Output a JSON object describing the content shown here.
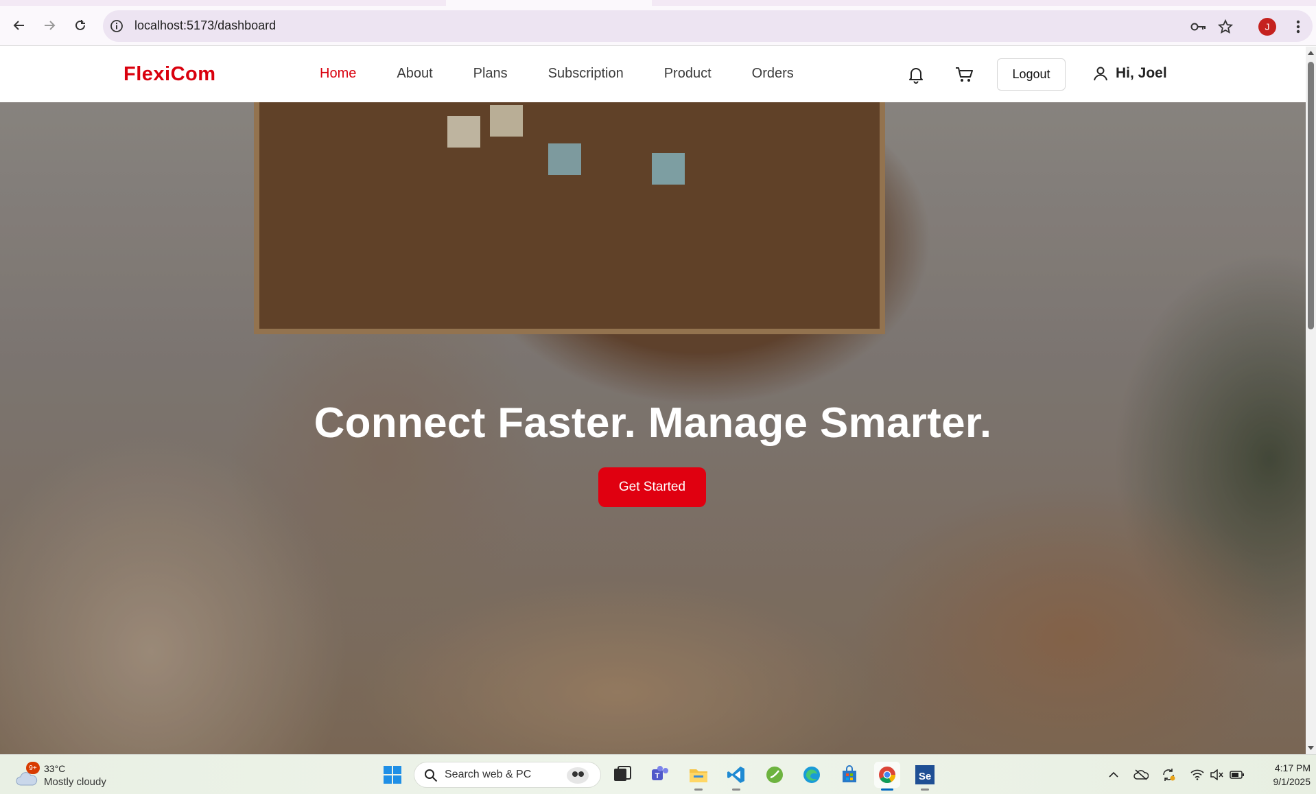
{
  "browser": {
    "url": "localhost:5173/dashboard",
    "profile_initial": "J",
    "icons": [
      "back-icon",
      "forward-icon",
      "reload-icon",
      "site-info-icon",
      "password-key-icon",
      "bookmark-star-icon",
      "menu-kebab-icon"
    ]
  },
  "site": {
    "brand": "FlexiCom",
    "nav": [
      {
        "label": "Home",
        "active": true
      },
      {
        "label": "About",
        "active": false
      },
      {
        "label": "Plans",
        "active": false
      },
      {
        "label": "Subscription",
        "active": false
      },
      {
        "label": "Product",
        "active": false
      },
      {
        "label": "Orders",
        "active": false
      }
    ],
    "logout_label": "Logout",
    "greeting": "Hi, Joel",
    "accent_color": "#d9000d"
  },
  "hero": {
    "title": "Connect Faster. Manage Smarter.",
    "cta_label": "Get Started"
  },
  "taskbar": {
    "weather_badge": "9+",
    "temperature": "33°C",
    "condition": "Mostly cloudy",
    "search_placeholder": "Search web & PC",
    "time": "4:17 PM",
    "date": "9/1/2025",
    "apps": [
      "windows-start-icon",
      "task-view-icon",
      "teams-icon",
      "file-explorer-icon",
      "vscode-icon",
      "spring-tool-icon",
      "edge-icon",
      "store-icon",
      "chrome-icon",
      "selenium-icon"
    ]
  }
}
